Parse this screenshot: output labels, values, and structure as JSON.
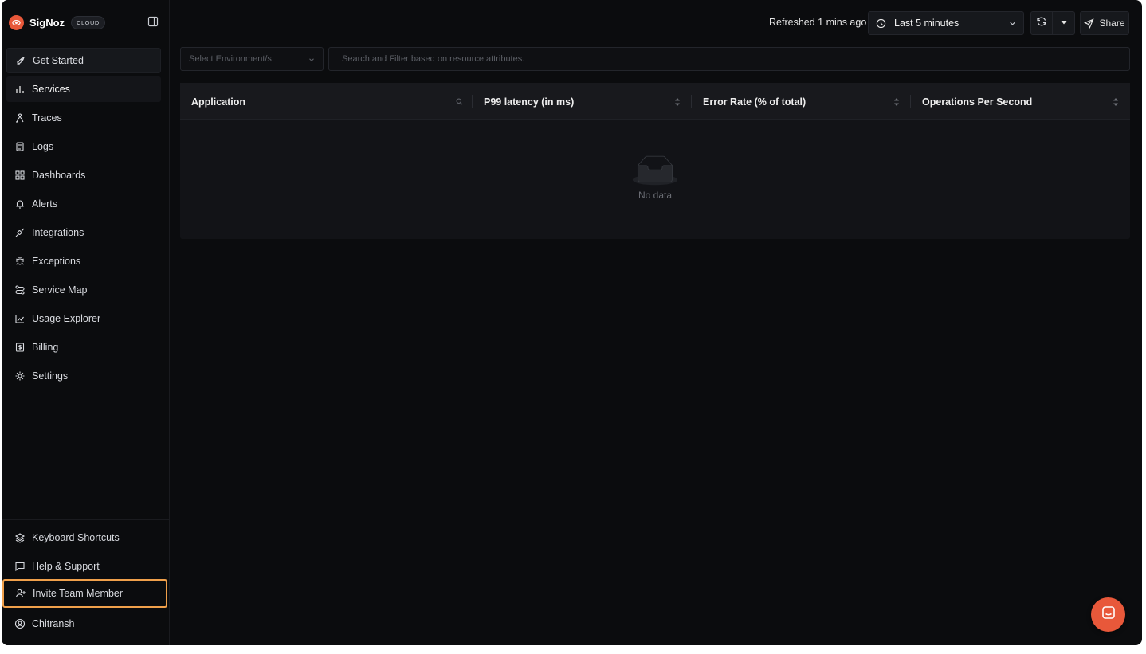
{
  "brand": {
    "name": "SigNoz",
    "badge": "CLOUD"
  },
  "sidebar": {
    "items": [
      {
        "label": "Get Started",
        "icon": "rocket-icon"
      },
      {
        "label": "Services",
        "icon": "bar-chart-icon"
      },
      {
        "label": "Traces",
        "icon": "traces-icon"
      },
      {
        "label": "Logs",
        "icon": "logs-scroll-icon"
      },
      {
        "label": "Dashboards",
        "icon": "dashboard-grid-icon"
      },
      {
        "label": "Alerts",
        "icon": "bell-icon"
      },
      {
        "label": "Integrations",
        "icon": "plug-icon"
      },
      {
        "label": "Exceptions",
        "icon": "bug-icon"
      },
      {
        "label": "Service Map",
        "icon": "route-map-icon"
      },
      {
        "label": "Usage Explorer",
        "icon": "area-chart-icon"
      },
      {
        "label": "Billing",
        "icon": "receipt-dollar-icon"
      },
      {
        "label": "Settings",
        "icon": "gear-icon"
      }
    ],
    "bottom": [
      {
        "label": "Keyboard Shortcuts",
        "icon": "layers-icon"
      },
      {
        "label": "Help & Support",
        "icon": "message-square-icon"
      },
      {
        "label": "Invite Team Member",
        "icon": "user-plus-icon"
      },
      {
        "label": "Chitransh",
        "icon": "user-circle-icon"
      }
    ],
    "active": "Services",
    "highlighted": "Invite Team Member"
  },
  "topbar": {
    "refreshed": "Refreshed 1 mins ago",
    "time_range": "Last 5 minutes",
    "share_label": "Share"
  },
  "filters": {
    "environment_placeholder": "Select Environment/s",
    "search_placeholder": "Search and Filter based on resource attributes."
  },
  "table": {
    "columns": [
      "Application",
      "P99 latency (in ms)",
      "Error Rate (% of total)",
      "Operations Per Second"
    ],
    "rows": [],
    "empty_text": "No data"
  },
  "colors": {
    "background": "#0b0c0e",
    "brand": "#e8583a",
    "highlight_border": "#f0a04b"
  }
}
